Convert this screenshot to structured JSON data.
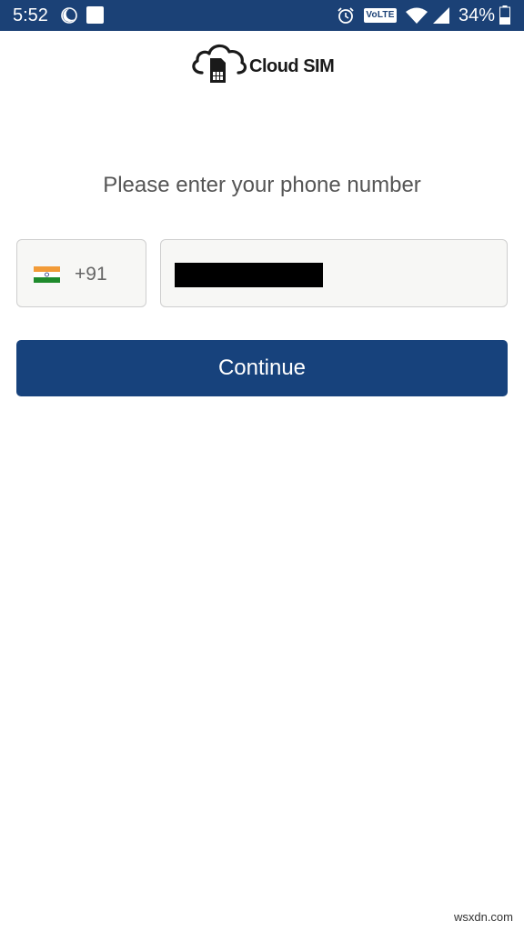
{
  "status_bar": {
    "time": "5:52",
    "network_badge": "VoLTE",
    "battery_percent": "34%",
    "icons": [
      "moon-icon",
      "notification-icon",
      "alarm-icon",
      "wifi-icon",
      "signal-icon",
      "battery-icon"
    ],
    "background_color": "#1b4176"
  },
  "logo": {
    "text": "Cloud SIM",
    "icon": "cloud-sim-icon"
  },
  "prompt": "Please enter your phone number",
  "country": {
    "flag": "india-flag-icon",
    "dial_code": "+91"
  },
  "phone": {
    "value_redacted": true
  },
  "continue_label": "Continue",
  "accent_color": "#17427c",
  "watermark": "wsxdn.com"
}
